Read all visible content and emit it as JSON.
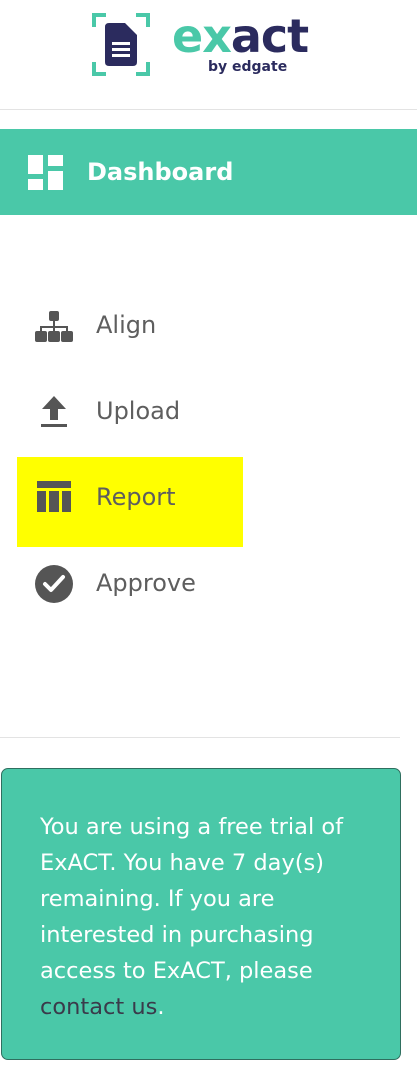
{
  "brand": {
    "name_part1": "ex",
    "name_part2": "act",
    "subtitle": "by edgate",
    "primary_color": "#4ac8a8",
    "dark_color": "#2b2b5e"
  },
  "dashboard": {
    "label": "Dashboard",
    "icon": "dashboard-grid-icon",
    "background": "#4ac8a8"
  },
  "nav": {
    "items": [
      {
        "label": "Align",
        "icon": "hierarchy-icon",
        "active": false
      },
      {
        "label": "Upload",
        "icon": "upload-icon",
        "active": false
      },
      {
        "label": "Report",
        "icon": "table-columns-icon",
        "active": true
      },
      {
        "label": "Approve",
        "icon": "check-circle-icon",
        "active": false
      }
    ],
    "highlight_color": "#ffff00"
  },
  "trial": {
    "text_before": "You are using a free trial of ExACT. You have 7 day(s) remaining. If you are interested in purchasing access to ExACT, please ",
    "link_text": "contact us",
    "text_after": "."
  }
}
